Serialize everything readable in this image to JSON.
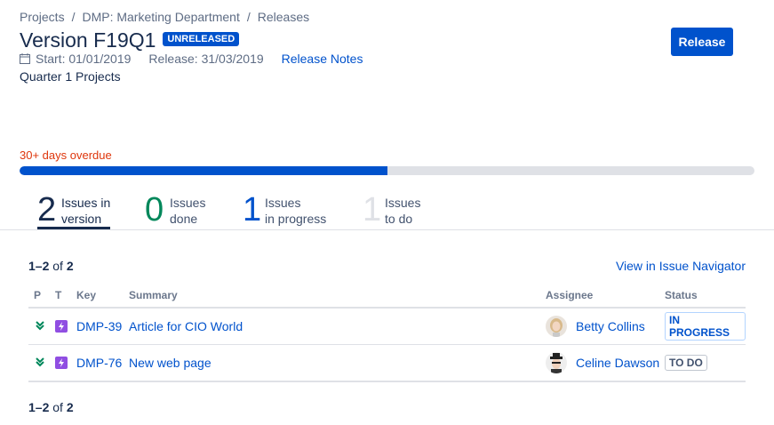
{
  "breadcrumb": [
    "Projects",
    "DMP: Marketing Department",
    "Releases"
  ],
  "version": {
    "title": "Version F19Q1",
    "status": "UNRELEASED",
    "start": "Start: 01/01/2019",
    "release": "Release: 31/03/2019",
    "notes_link": "Release Notes",
    "description": "Quarter 1 Projects"
  },
  "release_button": "Release",
  "progress": {
    "label": "30+ days overdue",
    "done_fraction": 0.5
  },
  "stats": [
    {
      "num": "2",
      "label1": "Issues in",
      "label2": "version"
    },
    {
      "num": "0",
      "label1": "Issues",
      "label2": "done"
    },
    {
      "num": "1",
      "label1": "Issues",
      "label2": "in progress"
    },
    {
      "num": "1",
      "label1": "Issues",
      "label2": "to do"
    }
  ],
  "count": {
    "range": "1–2",
    "of": "of",
    "total": "2"
  },
  "issue_navigator": "View in Issue Navigator",
  "table": {
    "headers": [
      "P",
      "T",
      "Key",
      "Summary",
      "Assignee",
      "Status"
    ],
    "rows": [
      {
        "key": "DMP-39",
        "summary": "Article for CIO World",
        "assignee": "Betty Collins",
        "status": "IN PROGRESS"
      },
      {
        "key": "DMP-76",
        "summary": "New web page",
        "assignee": "Celine Dawson",
        "status": "TO DO"
      }
    ]
  },
  "colors": {
    "primary": "#0052cc",
    "overdue": "#de350b",
    "done": "#00875a",
    "epic": "#904ee2"
  }
}
